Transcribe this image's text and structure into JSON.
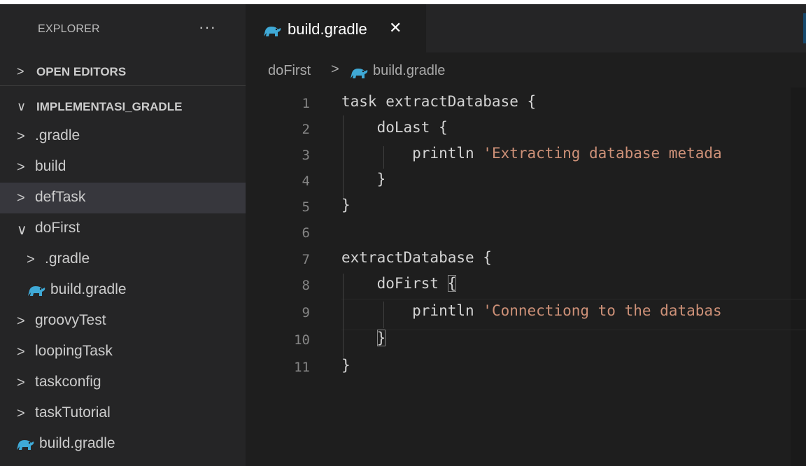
{
  "sidebar": {
    "title": "EXPLORER",
    "more": "···",
    "open_editors": {
      "chevron": ">",
      "label": "OPEN EDITORS"
    },
    "project": {
      "chevron": "∨",
      "label": "IMPLEMENTASI_GRADLE"
    },
    "items": [
      {
        "chevron": ">",
        "label": ".gradle"
      },
      {
        "chevron": ">",
        "label": "build"
      },
      {
        "chevron": ">",
        "label": "defTask"
      },
      {
        "chevron": "∨",
        "label": "doFirst"
      },
      {
        "chevron": ">",
        "label": ".gradle"
      },
      {
        "chevron": "",
        "label": "build.gradle"
      },
      {
        "chevron": ">",
        "label": "groovyTest"
      },
      {
        "chevron": ">",
        "label": "loopingTask"
      },
      {
        "chevron": ">",
        "label": "taskconfig"
      },
      {
        "chevron": ">",
        "label": "taskTutorial"
      },
      {
        "chevron": "",
        "label": "build.gradle"
      }
    ]
  },
  "tab": {
    "label": "build.gradle",
    "close": "✕",
    "icon": "gradle-elephant-icon"
  },
  "breadcrumb": {
    "folder": "doFirst",
    "separator": ">",
    "file": "build.gradle"
  },
  "editor": {
    "line_numbers": [
      "1",
      "2",
      "3",
      "4",
      "5",
      "6",
      "7",
      "8",
      "9",
      "10",
      "11"
    ],
    "lines": [
      "task extractDatabase {",
      "    doLast {",
      "        println ",
      "    }",
      "}",
      "",
      "extractDatabase {",
      "    doFirst ",
      "        println ",
      "    ",
      "}"
    ],
    "strings": {
      "line3": "'Extracting database metada",
      "line9": "'Connectiong to the databas"
    },
    "bracket_open": "{",
    "bracket_close": "}"
  },
  "colors": {
    "gradle_icon": "#3fa9d6",
    "string": "#ce9178",
    "selected_row": "#37373d"
  }
}
